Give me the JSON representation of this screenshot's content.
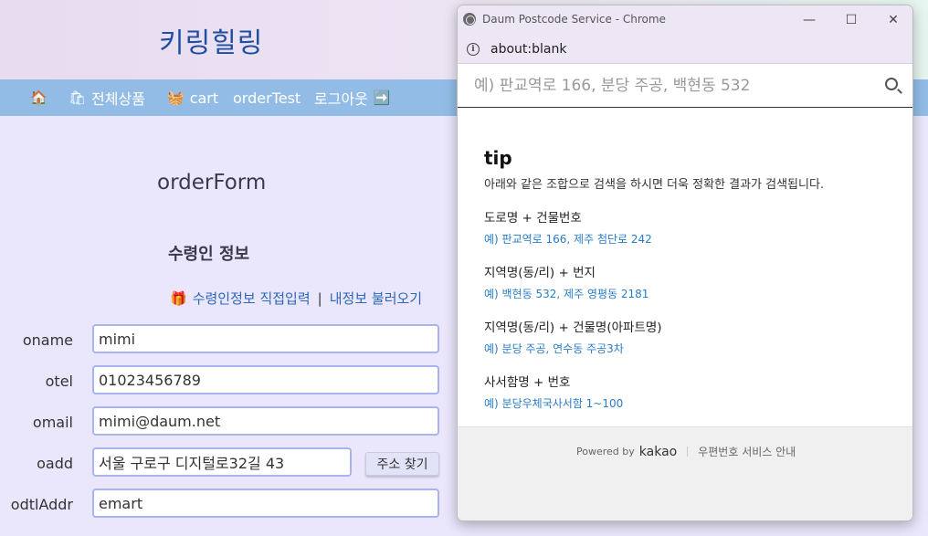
{
  "header": {
    "brand": "키링힐링"
  },
  "nav": {
    "home_icon": "🏠",
    "products_icon": "🛍",
    "products": "전체상품",
    "cart_icon": "🧺",
    "cart": "cart",
    "order_test": "orderTest",
    "logout": "로그아웃",
    "logout_icon": "➡️"
  },
  "main": {
    "title": "orderForm",
    "section_title": "수령인 정보",
    "gift_icon": "🎁",
    "link_direct": "수령인정보 직접입력",
    "link_sep": "|",
    "link_load": "내정보 불러오기",
    "fields": {
      "oname": {
        "label": "oname",
        "value": "mimi"
      },
      "otel": {
        "label": "otel",
        "value": "01023456789"
      },
      "omail": {
        "label": "omail",
        "value": "mimi@daum.net"
      },
      "oadd": {
        "label": "oadd",
        "value": "서울 구로구 디지털로32길 43"
      },
      "odtlAddr": {
        "label": "odtlAddr",
        "value": "emart"
      }
    },
    "find_address_button": "주소 찾기"
  },
  "popup": {
    "window_title": "Daum Postcode Service - Chrome",
    "url": "about:blank",
    "search_placeholder": "예) 판교역로 166, 분당 주공, 백현동 532",
    "tip_title": "tip",
    "tip_desc": "아래와 같은 조합으로 검색을 하시면 더욱 정확한 결과가 검색됩니다.",
    "tips": [
      {
        "label": "도로명 + 건물번호",
        "example": "예) 판교역로 166,  제주 첨단로 242"
      },
      {
        "label": "지역명(동/리) + 번지",
        "example": "예) 백현동 532,  제주 영평동 2181"
      },
      {
        "label": "지역명(동/리) + 건물명(아파트명)",
        "example": "예) 분당 주공,  연수동 주공3차"
      },
      {
        "label": "사서함명 + 번호",
        "example": "예) 분당우체국사서함 1~100"
      }
    ],
    "powered_by": "Powered by",
    "kakao": "kakao",
    "service_info": "우편번호 서비스 안내",
    "minimize": "—",
    "maximize": "☐",
    "close": "✕",
    "info": "i"
  }
}
